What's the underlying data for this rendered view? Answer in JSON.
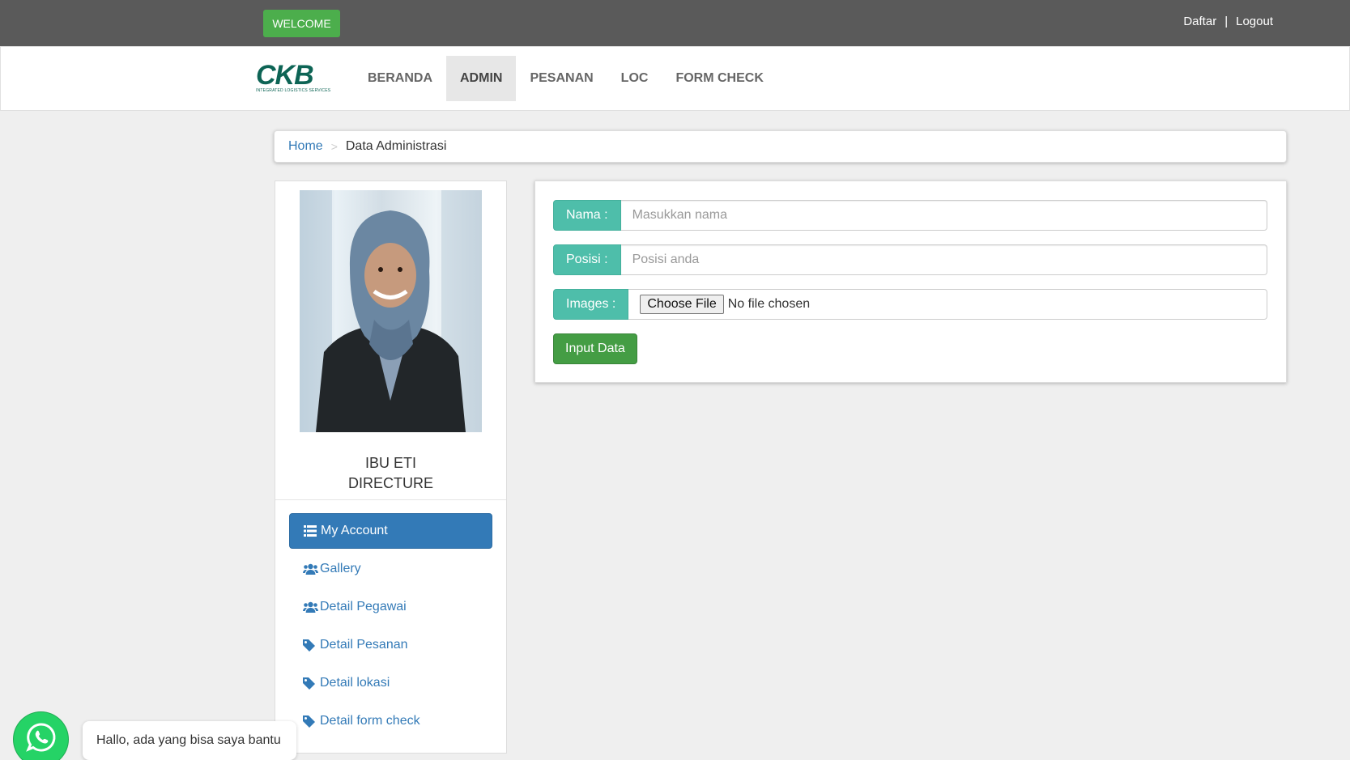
{
  "topbar": {
    "welcome_label": "WELCOME",
    "daftar_label": "Daftar",
    "separator": "|",
    "logout_label": "Logout"
  },
  "brand": {
    "logo_text": "CKB",
    "logo_subtitle": "INTEGRATED LOGISTICS SERVICES",
    "color": "#0d6455"
  },
  "nav": {
    "items": [
      {
        "label": "BERANDA",
        "active": false
      },
      {
        "label": "ADMIN",
        "active": true
      },
      {
        "label": "PESANAN",
        "active": false
      },
      {
        "label": "LOC",
        "active": false
      },
      {
        "label": "FORM CHECK",
        "active": false
      }
    ]
  },
  "breadcrumb": {
    "home": "Home",
    "separator": ">",
    "current": "Data Administrasi"
  },
  "profile": {
    "name": "IBU ETI",
    "position": "DIRECTURE"
  },
  "menu": {
    "items": [
      {
        "label": "My Account",
        "icon": "list-icon",
        "active": true
      },
      {
        "label": "Gallery",
        "icon": "users-icon",
        "active": false
      },
      {
        "label": "Detail Pegawai",
        "icon": "users-icon",
        "active": false
      },
      {
        "label": "Detail Pesanan",
        "icon": "tag-icon",
        "active": false
      },
      {
        "label": "Detail lokasi",
        "icon": "tag-icon",
        "active": false
      },
      {
        "label": "Detail form check",
        "icon": "tag-icon",
        "active": false
      }
    ]
  },
  "form": {
    "nama_label": "Nama :",
    "nama_placeholder": "Masukkan nama",
    "posisi_label": "Posisi :",
    "posisi_placeholder": "Posisi anda",
    "images_label": "Images :",
    "file_button": "Choose File",
    "file_status": "No file chosen",
    "submit_label": "Input Data"
  },
  "whatsapp": {
    "message": "Hallo, ada yang bisa saya bantu"
  },
  "colors": {
    "accent": "#337ab7",
    "addon": "#4ebeaa",
    "success": "#449d44",
    "topbar": "#5a5a5a",
    "whatsapp": "#25d366"
  }
}
